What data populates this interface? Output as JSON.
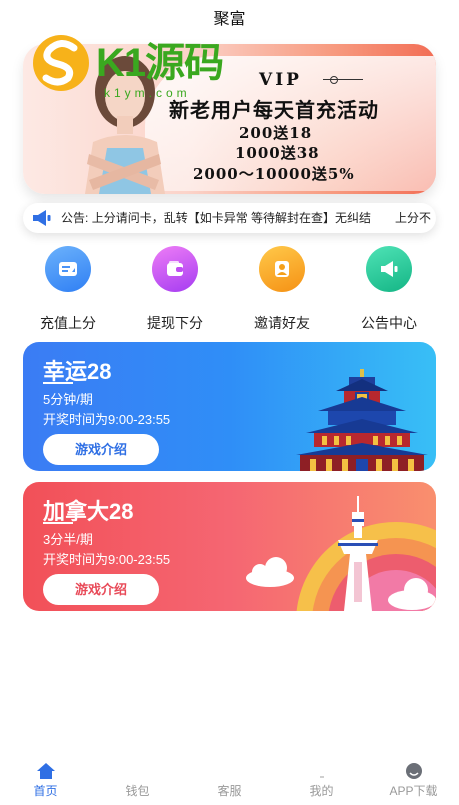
{
  "app": {
    "title": "聚富"
  },
  "banner": {
    "tag": "VIP",
    "headline": "新老用户每天首充活动",
    "lines": [
      "200送18",
      "1000送38",
      "2000～10000送5%"
    ]
  },
  "watermark": {
    "main": "K1源码",
    "sub": "k1ym.com"
  },
  "notice": {
    "label": "公告:",
    "text": "上分请问卡，乱转【如卡异常 等待解封在查】无纠结　　上分不"
  },
  "menu": [
    {
      "label": "充值上分",
      "icon": "recharge-icon",
      "color": "#3f8ff7"
    },
    {
      "label": "提现下分",
      "icon": "wallet-icon",
      "color": "#c04ef2"
    },
    {
      "label": "邀请好友",
      "icon": "invite-user-icon",
      "color": "#f9a51c"
    },
    {
      "label": "公告中心",
      "icon": "megaphone-icon",
      "color": "#22c79a"
    }
  ],
  "games": [
    {
      "name": "幸运28",
      "period": "5分钟/期",
      "hours": "开奖时间为9:00-23:55",
      "button": "游戏介绍"
    },
    {
      "name": "加拿大28",
      "period": "3分半/期",
      "hours": "开奖时间为9:00-23:55",
      "button": "游戏介绍"
    }
  ],
  "tabs": [
    {
      "label": "首页",
      "icon": "home-icon",
      "active": true
    },
    {
      "label": "钱包",
      "icon": "wallet-icon"
    },
    {
      "label": "客服",
      "icon": "service-icon"
    },
    {
      "label": "我的",
      "icon": "user-icon"
    },
    {
      "label": "APP下载",
      "icon": "download-icon"
    }
  ],
  "colors": {
    "accent": "#2f6fe4",
    "tab_inactive": "#999999"
  }
}
